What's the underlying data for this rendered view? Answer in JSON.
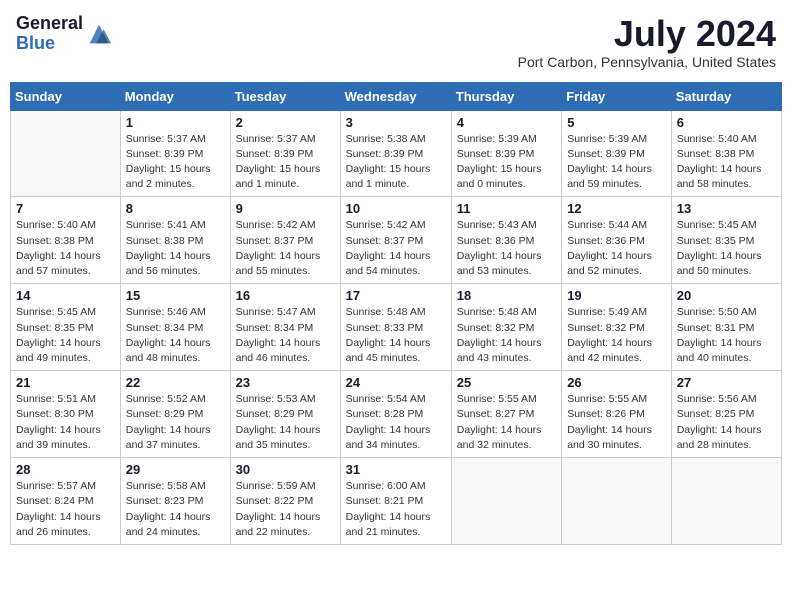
{
  "header": {
    "logo_general": "General",
    "logo_blue": "Blue",
    "month_title": "July 2024",
    "location": "Port Carbon, Pennsylvania, United States"
  },
  "days_of_week": [
    "Sunday",
    "Monday",
    "Tuesday",
    "Wednesday",
    "Thursday",
    "Friday",
    "Saturday"
  ],
  "weeks": [
    [
      {
        "day": "",
        "info": ""
      },
      {
        "day": "1",
        "info": "Sunrise: 5:37 AM\nSunset: 8:39 PM\nDaylight: 15 hours\nand 2 minutes."
      },
      {
        "day": "2",
        "info": "Sunrise: 5:37 AM\nSunset: 8:39 PM\nDaylight: 15 hours\nand 1 minute."
      },
      {
        "day": "3",
        "info": "Sunrise: 5:38 AM\nSunset: 8:39 PM\nDaylight: 15 hours\nand 1 minute."
      },
      {
        "day": "4",
        "info": "Sunrise: 5:39 AM\nSunset: 8:39 PM\nDaylight: 15 hours\nand 0 minutes."
      },
      {
        "day": "5",
        "info": "Sunrise: 5:39 AM\nSunset: 8:39 PM\nDaylight: 14 hours\nand 59 minutes."
      },
      {
        "day": "6",
        "info": "Sunrise: 5:40 AM\nSunset: 8:38 PM\nDaylight: 14 hours\nand 58 minutes."
      }
    ],
    [
      {
        "day": "7",
        "info": "Sunrise: 5:40 AM\nSunset: 8:38 PM\nDaylight: 14 hours\nand 57 minutes."
      },
      {
        "day": "8",
        "info": "Sunrise: 5:41 AM\nSunset: 8:38 PM\nDaylight: 14 hours\nand 56 minutes."
      },
      {
        "day": "9",
        "info": "Sunrise: 5:42 AM\nSunset: 8:37 PM\nDaylight: 14 hours\nand 55 minutes."
      },
      {
        "day": "10",
        "info": "Sunrise: 5:42 AM\nSunset: 8:37 PM\nDaylight: 14 hours\nand 54 minutes."
      },
      {
        "day": "11",
        "info": "Sunrise: 5:43 AM\nSunset: 8:36 PM\nDaylight: 14 hours\nand 53 minutes."
      },
      {
        "day": "12",
        "info": "Sunrise: 5:44 AM\nSunset: 8:36 PM\nDaylight: 14 hours\nand 52 minutes."
      },
      {
        "day": "13",
        "info": "Sunrise: 5:45 AM\nSunset: 8:35 PM\nDaylight: 14 hours\nand 50 minutes."
      }
    ],
    [
      {
        "day": "14",
        "info": "Sunrise: 5:45 AM\nSunset: 8:35 PM\nDaylight: 14 hours\nand 49 minutes."
      },
      {
        "day": "15",
        "info": "Sunrise: 5:46 AM\nSunset: 8:34 PM\nDaylight: 14 hours\nand 48 minutes."
      },
      {
        "day": "16",
        "info": "Sunrise: 5:47 AM\nSunset: 8:34 PM\nDaylight: 14 hours\nand 46 minutes."
      },
      {
        "day": "17",
        "info": "Sunrise: 5:48 AM\nSunset: 8:33 PM\nDaylight: 14 hours\nand 45 minutes."
      },
      {
        "day": "18",
        "info": "Sunrise: 5:48 AM\nSunset: 8:32 PM\nDaylight: 14 hours\nand 43 minutes."
      },
      {
        "day": "19",
        "info": "Sunrise: 5:49 AM\nSunset: 8:32 PM\nDaylight: 14 hours\nand 42 minutes."
      },
      {
        "day": "20",
        "info": "Sunrise: 5:50 AM\nSunset: 8:31 PM\nDaylight: 14 hours\nand 40 minutes."
      }
    ],
    [
      {
        "day": "21",
        "info": "Sunrise: 5:51 AM\nSunset: 8:30 PM\nDaylight: 14 hours\nand 39 minutes."
      },
      {
        "day": "22",
        "info": "Sunrise: 5:52 AM\nSunset: 8:29 PM\nDaylight: 14 hours\nand 37 minutes."
      },
      {
        "day": "23",
        "info": "Sunrise: 5:53 AM\nSunset: 8:29 PM\nDaylight: 14 hours\nand 35 minutes."
      },
      {
        "day": "24",
        "info": "Sunrise: 5:54 AM\nSunset: 8:28 PM\nDaylight: 14 hours\nand 34 minutes."
      },
      {
        "day": "25",
        "info": "Sunrise: 5:55 AM\nSunset: 8:27 PM\nDaylight: 14 hours\nand 32 minutes."
      },
      {
        "day": "26",
        "info": "Sunrise: 5:55 AM\nSunset: 8:26 PM\nDaylight: 14 hours\nand 30 minutes."
      },
      {
        "day": "27",
        "info": "Sunrise: 5:56 AM\nSunset: 8:25 PM\nDaylight: 14 hours\nand 28 minutes."
      }
    ],
    [
      {
        "day": "28",
        "info": "Sunrise: 5:57 AM\nSunset: 8:24 PM\nDaylight: 14 hours\nand 26 minutes."
      },
      {
        "day": "29",
        "info": "Sunrise: 5:58 AM\nSunset: 8:23 PM\nDaylight: 14 hours\nand 24 minutes."
      },
      {
        "day": "30",
        "info": "Sunrise: 5:59 AM\nSunset: 8:22 PM\nDaylight: 14 hours\nand 22 minutes."
      },
      {
        "day": "31",
        "info": "Sunrise: 6:00 AM\nSunset: 8:21 PM\nDaylight: 14 hours\nand 21 minutes."
      },
      {
        "day": "",
        "info": ""
      },
      {
        "day": "",
        "info": ""
      },
      {
        "day": "",
        "info": ""
      }
    ]
  ]
}
